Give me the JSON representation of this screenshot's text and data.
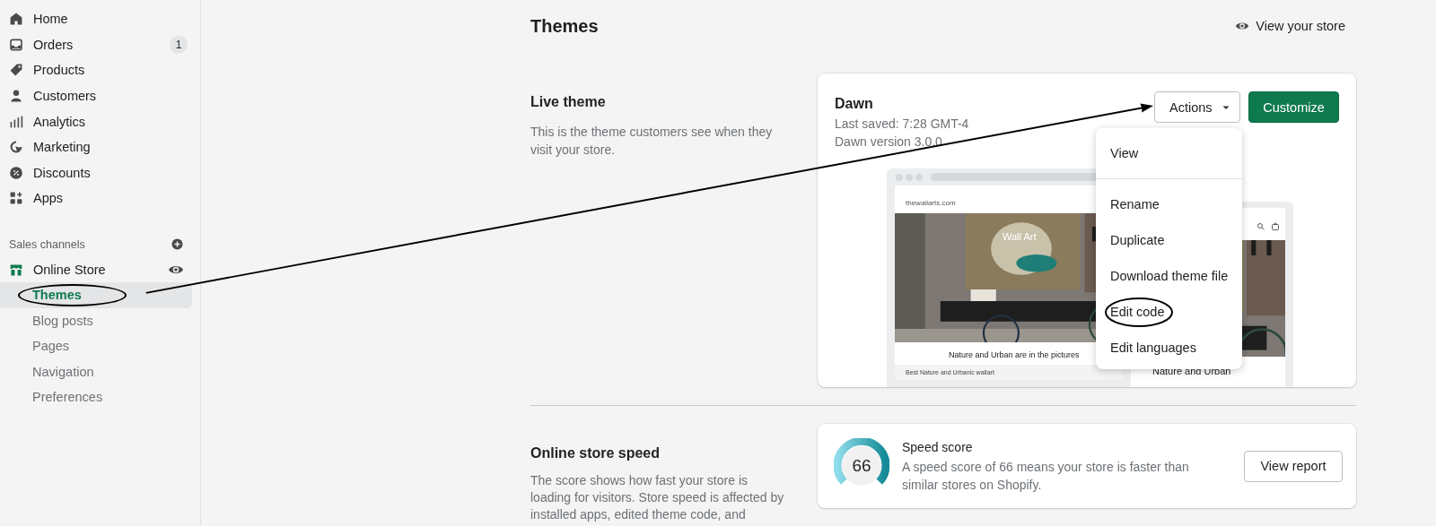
{
  "sidebar": {
    "items": [
      {
        "label": "Home"
      },
      {
        "label": "Orders",
        "badge": "1"
      },
      {
        "label": "Products"
      },
      {
        "label": "Customers"
      },
      {
        "label": "Analytics"
      },
      {
        "label": "Marketing"
      },
      {
        "label": "Discounts"
      },
      {
        "label": "Apps"
      }
    ],
    "sales_channels": {
      "heading": "Sales channels",
      "channel": "Online Store",
      "subitems": [
        {
          "label": "Themes",
          "selected": true,
          "circled": true
        },
        {
          "label": "Blog posts",
          "selected": false,
          "circled": false
        },
        {
          "label": "Pages",
          "selected": false,
          "circled": false
        },
        {
          "label": "Navigation",
          "selected": false,
          "circled": false
        },
        {
          "label": "Preferences",
          "selected": false,
          "circled": false
        }
      ]
    }
  },
  "page": {
    "title": "Themes",
    "view_store": "View your store"
  },
  "live_theme": {
    "heading": "Live theme",
    "description": "This is the theme customers see when they visit your store.",
    "theme": {
      "name": "Dawn",
      "last_saved": "Last saved: 7:28 GMT-4",
      "version": "Dawn version 3.0.0"
    },
    "actions_button": "Actions",
    "customize_button": "Customize",
    "actions_menu": {
      "expanded": true,
      "sections": [
        [
          {
            "label": "View",
            "circled": false
          }
        ],
        [
          {
            "label": "Rename",
            "circled": false
          },
          {
            "label": "Duplicate",
            "circled": false
          },
          {
            "label": "Download theme file",
            "circled": false
          },
          {
            "label": "Edit code",
            "circled": true
          },
          {
            "label": "Edit languages",
            "circled": false
          }
        ]
      ]
    },
    "preview": {
      "desktop": {
        "site_name": "thewallarts.com",
        "hero_title": "Wall Art",
        "heading": "Nature and Urban are in the pictures",
        "banner": "Best Nature and Urbanic wallart"
      },
      "mobile": {
        "heading": "Nature and Urban"
      }
    }
  },
  "speed": {
    "heading": "Online store speed",
    "description": "The score shows how fast your store is loading for visitors. Store speed is affected by installed apps, edited theme code, and",
    "score": "66",
    "title": "Speed score",
    "text": "A speed score of 66 means your store is faster than similar stores on Shopify.",
    "button": "View report"
  }
}
